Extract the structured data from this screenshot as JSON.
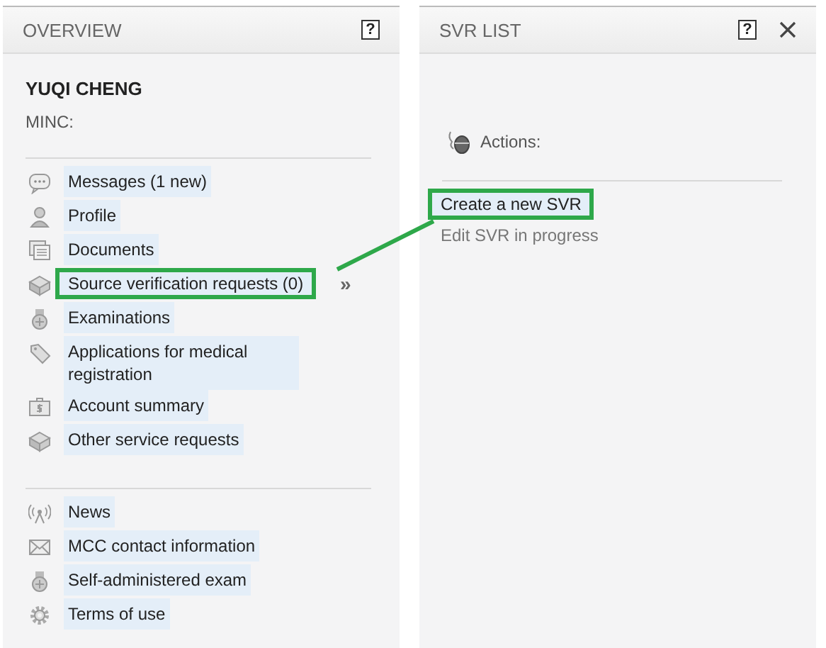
{
  "overview": {
    "title": "OVERVIEW",
    "help_glyph": "?",
    "user_name": "YUQI CHENG",
    "minc_label": "MINC:",
    "menu_groups": [
      [
        {
          "kind": "message",
          "label": "Messages (1 new)",
          "highlighted": false
        },
        {
          "kind": "person",
          "label": "Profile",
          "highlighted": false
        },
        {
          "kind": "documents",
          "label": "Documents",
          "highlighted": false
        },
        {
          "kind": "box",
          "label": "Source verification requests (0)",
          "highlighted": true,
          "expand_glyph": "»"
        },
        {
          "kind": "medal",
          "label": "Examinations",
          "highlighted": false
        },
        {
          "kind": "tag",
          "label": "Applications for medical registration",
          "highlighted": false
        },
        {
          "kind": "wallet",
          "label": "Account summary",
          "highlighted": false
        },
        {
          "kind": "box",
          "label": "Other service requests",
          "highlighted": false
        }
      ],
      [
        {
          "kind": "antenna",
          "label": "News",
          "highlighted": false
        },
        {
          "kind": "mail",
          "label": "MCC contact information",
          "highlighted": false
        },
        {
          "kind": "medal",
          "label": "Self-administered exam",
          "highlighted": false
        },
        {
          "kind": "gear",
          "label": "Terms of use",
          "highlighted": false
        }
      ]
    ]
  },
  "svr_list": {
    "title": "SVR LIST",
    "help_glyph": "?",
    "actions_label": "Actions:",
    "links": [
      {
        "label": "Create a new SVR",
        "highlighted": true,
        "disabled": false
      },
      {
        "label": "Edit SVR in progress",
        "highlighted": false,
        "disabled": true
      }
    ]
  }
}
